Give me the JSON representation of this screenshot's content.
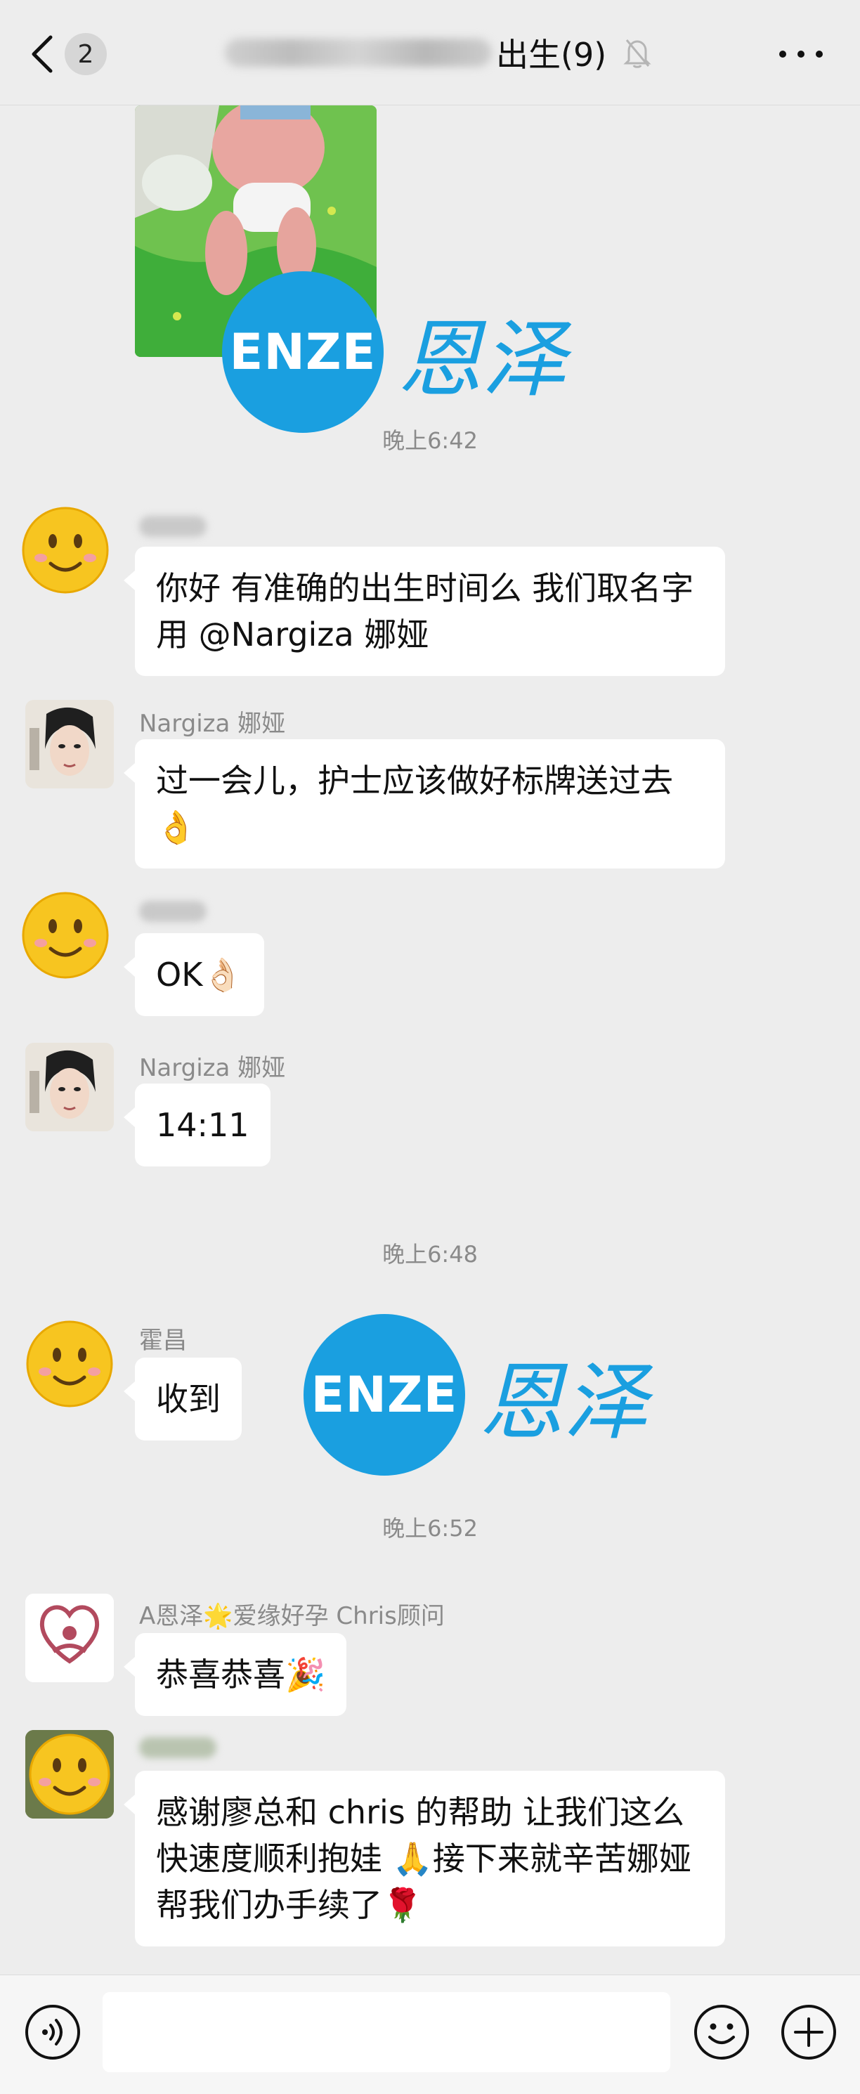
{
  "header": {
    "back_count": "2",
    "title": "出生(9)"
  },
  "messages": {
    "ts1": "晚上6:42",
    "m1_text": "你好 有准确的出生时间么  我们取名字用 @Nargiza 娜娅",
    "m2_sender": "Nargiza 娜娅",
    "m2_text": "过一会儿，护士应该做好标牌送过去👌",
    "m3_text": "OK👌🏻",
    "m4_sender": "Nargiza 娜娅",
    "m4_text": "14:11",
    "ts2": "晚上6:48",
    "m5_sender": "霍昌",
    "m5_text": "收到",
    "ts3": "晚上6:52",
    "m6_sender": "A恩泽🌟爱缘好孕 Chris顾问",
    "m6_text": "恭喜恭喜🎉",
    "m7_text": "感谢廖总和 chris 的帮助 让我们这么快速度顺利抱娃 🙏接下来就辛苦娜娅  帮我们办手续了🌹"
  },
  "watermark": {
    "latin": "ENZE",
    "chinese": "恩泽"
  },
  "colors": {
    "background": "#ededed",
    "bubble": "#ffffff",
    "brand_blue": "#1a9fe0",
    "timestamp": "#8a8a8a"
  },
  "icons": {
    "back": "chevron-left-icon",
    "mute": "bell-slash-icon",
    "more": "more-dots-icon",
    "voice": "voice-icon",
    "emoji": "emoji-icon",
    "plus": "plus-icon"
  }
}
